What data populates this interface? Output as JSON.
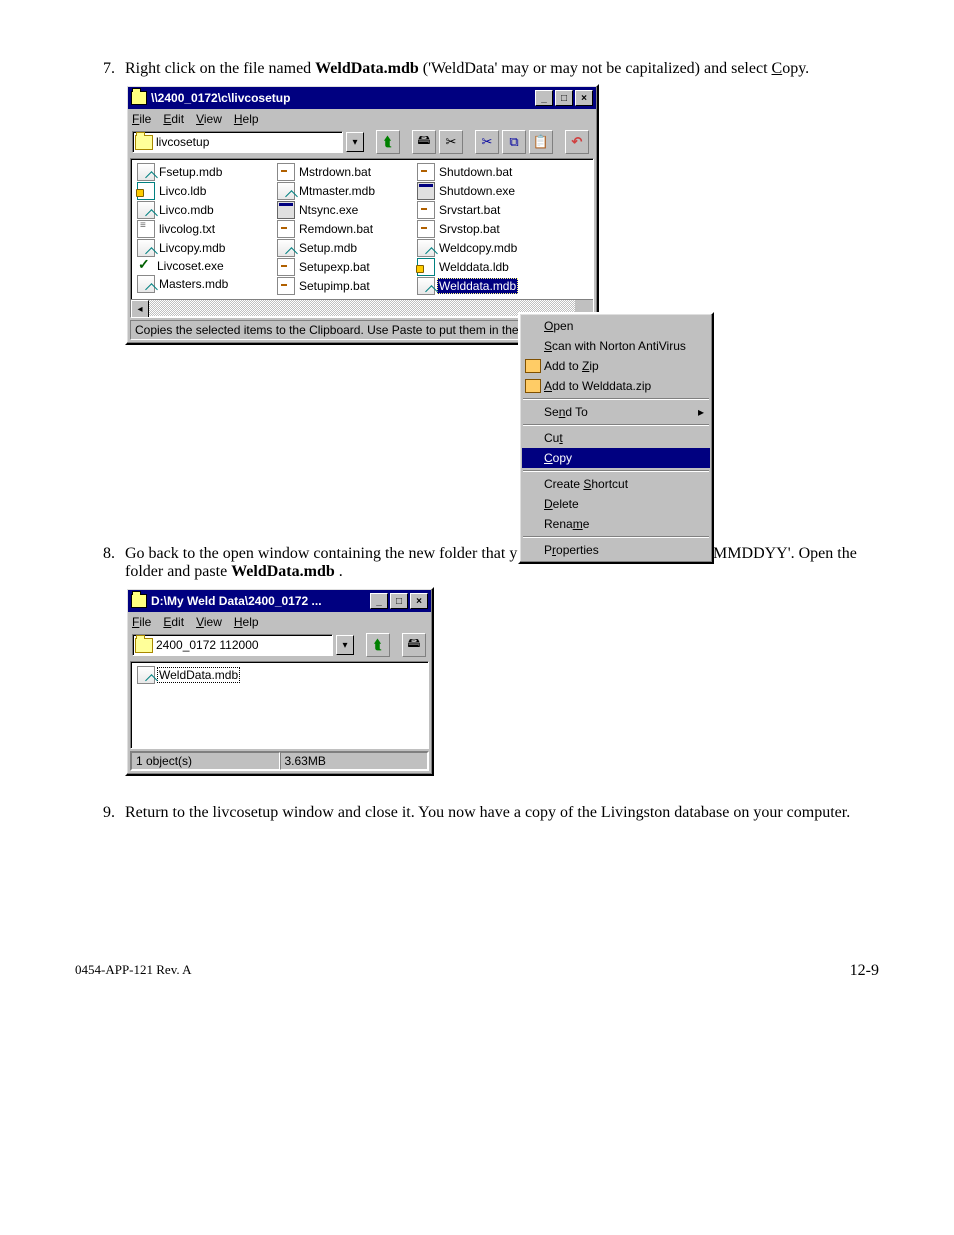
{
  "steps": {
    "s7": {
      "num": "7.",
      "pre": "Right click on the file named ",
      "bold": "WeldData.mdb",
      "mid": " ('WeldData' may or may not be capitalized) and select ",
      "copy_mnemonic": "C",
      "copy_rest": "opy."
    },
    "s8": {
      "num": "8.",
      "pre": "Go back to the open window containing the new folder that you created named '2400_xxxx MMDDYY'. Open the folder and paste ",
      "bold": "WeldData.mdb",
      "post": "."
    },
    "s9": {
      "num": "9.",
      "text": "Return to the livcosetup window and close it. You now have a copy of the Livingston database on your computer."
    }
  },
  "win1": {
    "title": "\\\\2400_0172\\c\\livcosetup",
    "menu": {
      "file": "File",
      "edit": "Edit",
      "view": "View",
      "help": "Help"
    },
    "addr": "livcosetup",
    "status": "Copies the selected items to the Clipboard. Use Paste to put them in the new location.",
    "cols": [
      [
        {
          "name": "Fsetup.mdb",
          "icon": "mdb"
        },
        {
          "name": "Livco.ldb",
          "icon": "ldb"
        },
        {
          "name": "Livco.mdb",
          "icon": "mdb"
        },
        {
          "name": "livcolog.txt",
          "icon": "txt"
        },
        {
          "name": "Livcopy.mdb",
          "icon": "mdb"
        },
        {
          "name": "Livcoset.exe",
          "icon": "chk"
        },
        {
          "name": "Masters.mdb",
          "icon": "mdb"
        }
      ],
      [
        {
          "name": "Mstrdown.bat",
          "icon": "bat"
        },
        {
          "name": "Mtmaster.mdb",
          "icon": "mdb"
        },
        {
          "name": "Ntsync.exe",
          "icon": "exe"
        },
        {
          "name": "Remdown.bat",
          "icon": "bat"
        },
        {
          "name": "Setup.mdb",
          "icon": "mdb"
        },
        {
          "name": "Setupexp.bat",
          "icon": "bat"
        },
        {
          "name": "Setupimp.bat",
          "icon": "bat"
        }
      ],
      [
        {
          "name": "Shutdown.bat",
          "icon": "bat"
        },
        {
          "name": "Shutdown.exe",
          "icon": "exe"
        },
        {
          "name": "Srvstart.bat",
          "icon": "bat"
        },
        {
          "name": "Srvstop.bat",
          "icon": "bat"
        },
        {
          "name": "Weldcopy.mdb",
          "icon": "mdb"
        },
        {
          "name": "Welddata.ldb",
          "icon": "ldb"
        },
        {
          "name": "Welddata.mdb",
          "icon": "mdb",
          "selected": true
        }
      ]
    ],
    "ctx": {
      "open": "Open",
      "scan": "Scan with Norton AntiVirus",
      "zip1": "Add to Zip",
      "zip2": "Add to Welddata.zip",
      "sendto": "Send To",
      "cut": "Cut",
      "copy": "Copy",
      "shortcut": "Create Shortcut",
      "delete": "Delete",
      "rename": "Rename",
      "props": "Properties"
    }
  },
  "win2": {
    "title": "D:\\My Weld Data\\2400_0172 ...",
    "menu": {
      "file": "File",
      "edit": "Edit",
      "view": "View",
      "help": "Help"
    },
    "addr": "2400_0172 112000",
    "file": "WeldData.mdb",
    "status_left": "1 object(s)",
    "status_right": "3.63MB"
  },
  "footer": {
    "left": "0454-APP-121 Rev. A",
    "right": "12-9"
  }
}
